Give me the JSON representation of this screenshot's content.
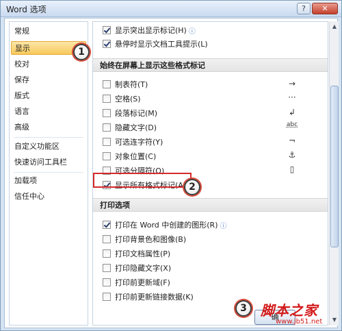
{
  "window": {
    "title": "Word 选项",
    "help_label": "?",
    "close_label": "✕"
  },
  "sidebar": {
    "items": [
      {
        "label": "常规"
      },
      {
        "label": "显示"
      },
      {
        "label": "校对"
      },
      {
        "label": "保存"
      },
      {
        "label": "版式"
      },
      {
        "label": "语言"
      },
      {
        "label": "高级"
      },
      {
        "label": "自定义功能区"
      },
      {
        "label": "快速访问工具栏"
      },
      {
        "label": "加载项"
      },
      {
        "label": "信任中心"
      }
    ],
    "selected": "显示"
  },
  "content": {
    "top_options": [
      {
        "label": "显示突出显示标记(H)",
        "checked": true,
        "info": "ⓘ"
      },
      {
        "label": "悬停时显示文档工具提示(L)",
        "checked": true
      }
    ],
    "formatting_section_title": "始终在屏幕上显示这些格式标记",
    "formatting_marks": [
      {
        "label": "制表符(T)",
        "checked": false,
        "symbol": "→"
      },
      {
        "label": "空格(S)",
        "checked": false,
        "symbol": "···"
      },
      {
        "label": "段落标记(M)",
        "checked": false,
        "symbol": "↲"
      },
      {
        "label": "隐藏文字(D)",
        "checked": false,
        "symbol": "abc"
      },
      {
        "label": "可选连字符(Y)",
        "checked": false,
        "symbol": "¬"
      },
      {
        "label": "对象位置(C)",
        "checked": false,
        "symbol": "⚓"
      },
      {
        "label": "可选分隔符(O)",
        "checked": false,
        "symbol": "▯"
      },
      {
        "label": "显示所有格式标记(A)",
        "checked": true
      }
    ],
    "print_section_title": "打印选项",
    "print_options": [
      {
        "label": "打印在 Word 中创建的图形(R)",
        "checked": true,
        "info": "ⓘ"
      },
      {
        "label": "打印背景色和图像(B)",
        "checked": false
      },
      {
        "label": "打印文档属性(P)",
        "checked": false
      },
      {
        "label": "打印隐藏文字(X)",
        "checked": false
      },
      {
        "label": "打印前更新域(F)",
        "checked": false
      },
      {
        "label": "打印前更新链接数据(K)",
        "checked": false
      }
    ]
  },
  "callouts": [
    "1",
    "2",
    "3"
  ],
  "footer": {
    "ok_label": "确"
  },
  "watermark": {
    "brand": "脚本之家",
    "url": "www.jb51.net"
  },
  "colors": {
    "accent_selection": "#f7c95b",
    "annotation_red": "#d52a2a"
  }
}
